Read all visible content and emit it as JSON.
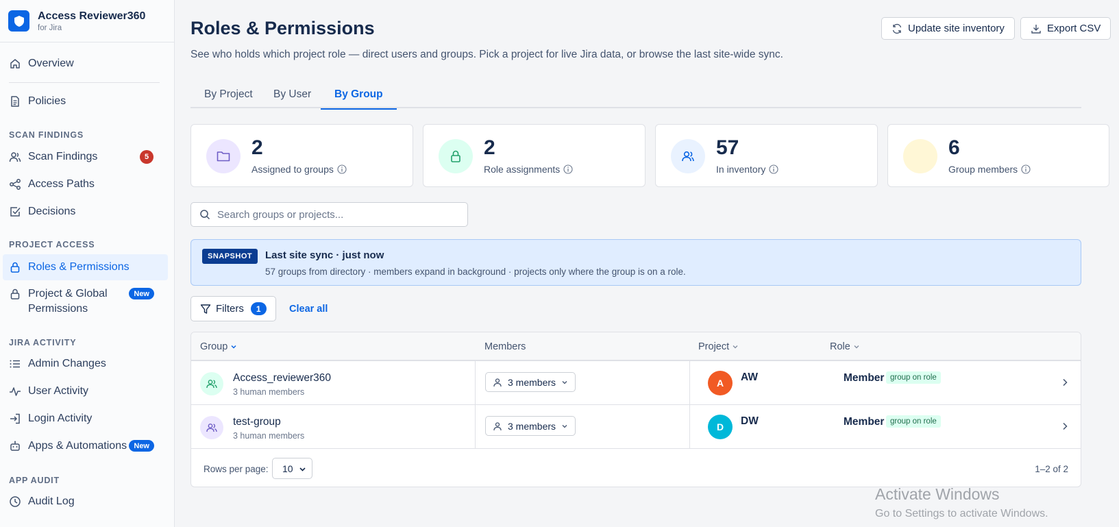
{
  "brand": {
    "name": "Access Reviewer360",
    "subtitle": "for Jira"
  },
  "sidebar": {
    "overview": "Overview",
    "policies": "Policies",
    "section_scan": "SCAN FINDINGS",
    "scan_findings": "Scan Findings",
    "scan_findings_count": "5",
    "access_paths": "Access Paths",
    "decisions": "Decisions",
    "section_project": "PROJECT ACCESS",
    "roles_permissions": "Roles & Permissions",
    "project_global_line1": "Project & Global",
    "project_global_line2": "Permissions",
    "new_badge": "New",
    "section_activity": "JIRA ACTIVITY",
    "admin_changes": "Admin Changes",
    "user_activity": "User Activity",
    "login_activity": "Login Activity",
    "apps_automations": "Apps & Automations",
    "section_audit": "APP AUDIT",
    "audit_log": "Audit Log"
  },
  "header": {
    "title": "Roles & Permissions",
    "description": "See who holds which project role — direct users and groups. Pick a project for live Jira data, or browse the last site-wide sync.",
    "update_button": "Update site inventory",
    "export_button": "Export CSV"
  },
  "tabs": {
    "by_project": "By Project",
    "by_user": "By User",
    "by_group": "By Group",
    "active": "By Group"
  },
  "stats": {
    "assigned": {
      "value": "2",
      "label": "Assigned to groups"
    },
    "roles": {
      "value": "2",
      "label": "Role assignments"
    },
    "inventory": {
      "value": "57",
      "label": "In inventory"
    },
    "members": {
      "value": "6",
      "label": "Group members"
    }
  },
  "search": {
    "placeholder": "Search groups or projects..."
  },
  "snapshot": {
    "badge": "SNAPSHOT",
    "title": "Last site sync · just now",
    "description": "57 groups from directory · members expand in background · projects only where the group is on a role."
  },
  "filters": {
    "label": "Filters",
    "count": "1",
    "clear": "Clear all"
  },
  "table": {
    "columns": {
      "group": "Group",
      "members": "Members",
      "project": "Project",
      "role": "Role"
    },
    "rows": [
      {
        "group": "Access_reviewer360",
        "sub": "3 human members",
        "members": "3 members",
        "avatar": "A",
        "avatar_color": "#f15a24",
        "project": "AW",
        "role": "Member",
        "tag": "group on role"
      },
      {
        "group": "test-group",
        "sub": "3 human members",
        "members": "3 members",
        "avatar": "D",
        "avatar_color": "#00b8d9",
        "project": "DW",
        "role": "Member",
        "tag": "group on role"
      }
    ],
    "rows_per_page_label": "Rows per page:",
    "rows_per_page": "10",
    "range": "1–2 of 2"
  },
  "watermark": {
    "title": "Activate Windows",
    "subtitle": "Go to Settings to activate Windows."
  },
  "colors": {
    "accent": "#0c66e4",
    "danger": "#c9372c",
    "snapshot_bg": "#e0edff"
  }
}
